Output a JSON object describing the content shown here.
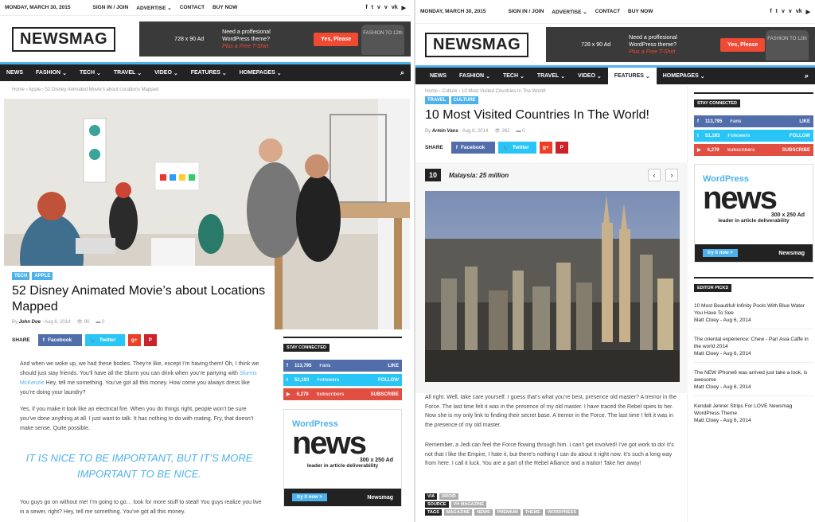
{
  "topbar": {
    "date": "MONDAY, MARCH 30, 2015",
    "signin": "SIGN IN / JOIN",
    "advertise": "ADVERTISE",
    "contact": "CONTACT",
    "buy": "BUY NOW",
    "social": [
      "f",
      "t",
      "v",
      "v",
      "vk",
      "yt"
    ]
  },
  "logo": "NEWSMAG",
  "ad": {
    "size": "728 x 90 Ad",
    "line1": "Need a proffesional",
    "line2": "WordPress theme?",
    "plus": "Plus a Free T-Shirt",
    "button": "Yes, Please",
    "shirt": "FASHION TO 12th"
  },
  "nav": {
    "items": [
      "NEWS",
      "FASHION",
      "TECH",
      "TRAVEL",
      "VIDEO",
      "FEATURES",
      "HOMEPAGES"
    ]
  },
  "left": {
    "crumbs": "Home  ›  Apple  ›  52 Disney Animated Movie's about Locations Mapped",
    "cats": [
      "TECH",
      "APPLE"
    ],
    "title": "52 Disney Animated Movie’s about Locations Mapped",
    "author": "John Doe",
    "date": "Aug 6, 2014",
    "views": "90",
    "comments": "0",
    "share": "SHARE",
    "facebook": "Facebook",
    "twitter": "Twitter",
    "p1a": "And when we woke up, we had these bodies. They’re like, except I’m having them! Oh, I think we should just stay friends. You’ll have all the Slurm you can drink when you’re partying with ",
    "p1link": "Slurms McKenzie",
    "p1b": " Hey, tell me something. You’ve got all this money. How come you always dress like you’re doing your laundry?",
    "p2": "Yes, if you make it look like an electrical fire. When you do things right, people won’t be sure you’ve done anything at all. I just want to talk. It has nothing to do with mating. Fry, that doesn’t make sense. Quite possible.",
    "quote": "IT IS NICE TO BE IMPORTANT, BUT IT’S MORE IMPORTANT TO BE NICE.",
    "p3": "You guys go on without me! I’m going to go… look for more stuff to steal! You guys realize you live in a sewer, right? Hey, tell me something. You’ve got all this money."
  },
  "right": {
    "crumbs": "Home  ›  Culture  ›  10 Most Visited Countries In The World!",
    "cats": [
      "TRAVEL",
      "CULTURE"
    ],
    "title": "10 Most Visited Countries In The World!",
    "author": "Armin Vans",
    "date": "Aug 6, 2014",
    "views": "262",
    "comments": "0",
    "share": "SHARE",
    "facebook": "Facebook",
    "twitter": "Twitter",
    "rank": "10",
    "rank_title": "Malaysia: 25 million",
    "p1": "All right. Well, take care yourself. I guess that’s what you’re best, presence old master? A tremor in the Force. The last time felt it was in the presence of my old master. I have traced the Rebel spies to her. Now she is my only link to finding their secret base. A tremor in the Force. The last time I felt it was in the presence of my old master.",
    "p2": "Remember, a Jedi can feel the Force flowing through him. I can’t get involved! I’ve got work to do! It’s not that I like the Empire, I hate it, but there’s nothing I can do about it right now. It’s such a long way from here. I call it luck. You are a part of the Rebel Alliance and a traitor! Take her away!",
    "via_label": "VIA",
    "via": "DROID",
    "source_label": "SOURCE",
    "source": "VH MAGAZINE",
    "tags_label": "TAGS",
    "tags": [
      "MAGAZINE",
      "NEWS",
      "PREMIUM",
      "THEME",
      "WORDPRESS"
    ]
  },
  "widget": {
    "stay": "STAY CONNECTED",
    "fb_count": "113,795",
    "fb_label": "Fans",
    "fb_action": "LIKE",
    "tw_count": "51,193",
    "tw_label": "Followers",
    "tw_action": "FOLLOW",
    "yt_count": "6,279",
    "yt_label": "Subscribers",
    "yt_action": "SUBSCRIBE",
    "ad_wp": "WordPress",
    "ad_news": "news",
    "ad_size": "300 x 250 Ad",
    "ad_lead": "leader in article deliverability",
    "ad_try": "try it now  >",
    "ad_brand": "Newsmag",
    "editor": "EDITOR PICKS",
    "picks": [
      {
        "title": "10 Most Beautifull Infinity Pools With Blue Water You Have To See",
        "by": "Matt Cloey",
        "date": "Aug 6, 2014"
      },
      {
        "title": "The oriental experience: Chew - Pan Asia Caffe in the world 2014",
        "by": "Matt Cloey",
        "date": "Aug 6, 2014"
      },
      {
        "title": "The NEW iPhone6 was arrived just take a look, is awesome",
        "by": "Matt Cloey",
        "date": "Aug 6, 2014"
      },
      {
        "title": "Kendall Jenner Strips For LOVE Newsmag WordPress Theme",
        "by": "Matt Cloey",
        "date": "Aug 6, 2014"
      }
    ]
  },
  "colors": {
    "accent": "#4db2ec",
    "dark": "#222222",
    "facebook": "#516eab",
    "twitter": "#29c5f6",
    "youtube": "#e14e42",
    "red": "#f04a33"
  }
}
